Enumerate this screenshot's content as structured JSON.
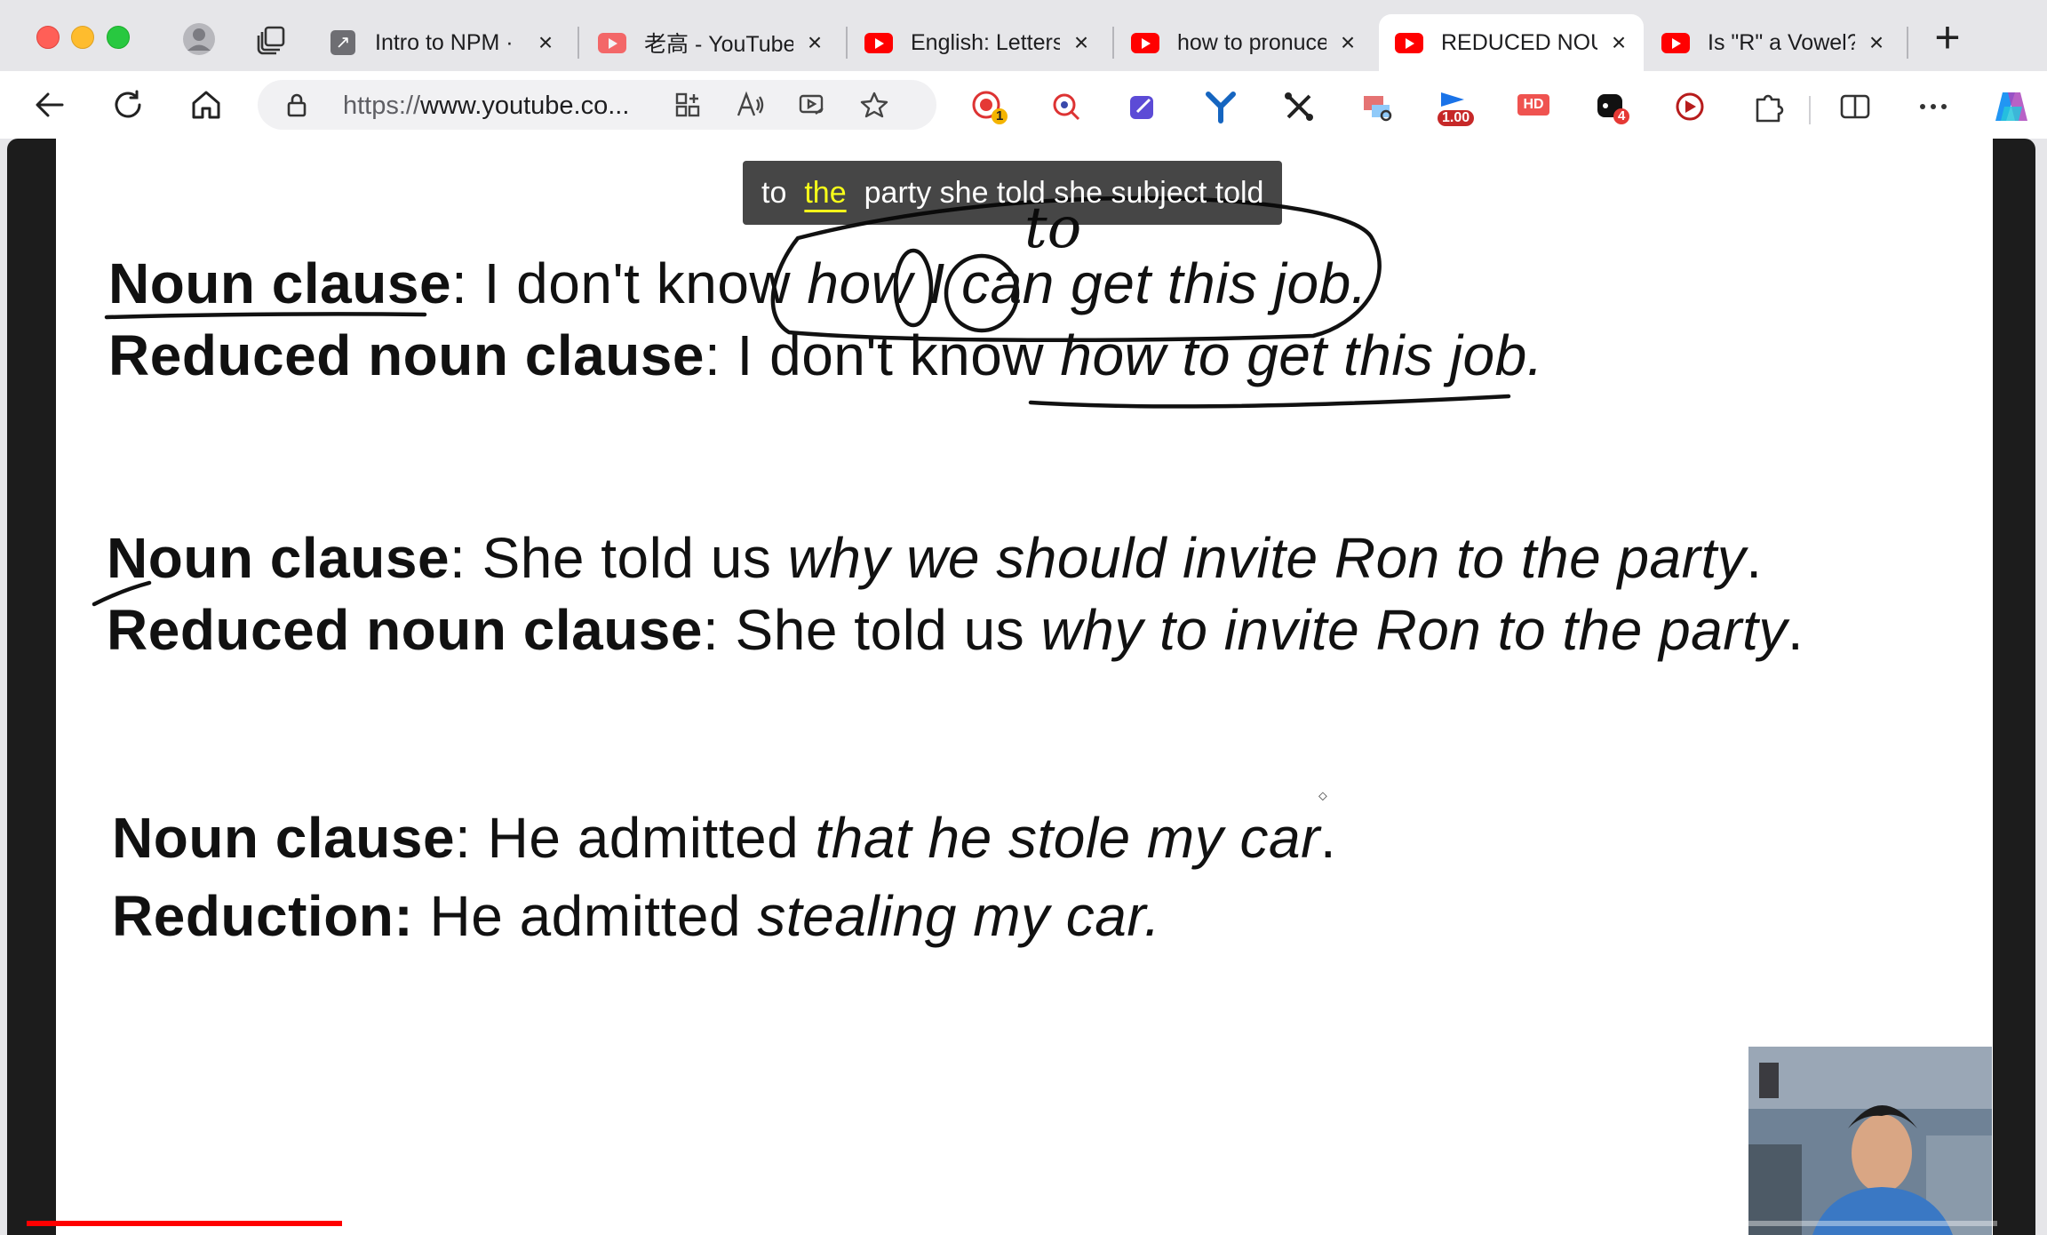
{
  "browser": {
    "tabs": [
      {
        "title": "Intro to NPM ·",
        "icon": "external-link-icon",
        "active": false
      },
      {
        "title": "老高 - YouTube",
        "icon": "youtube-icon",
        "active": false
      },
      {
        "title": "English: Letters",
        "icon": "youtube-icon",
        "active": false
      },
      {
        "title": "how to pronuce",
        "icon": "youtube-icon",
        "active": false
      },
      {
        "title": "REDUCED NOUN",
        "icon": "youtube-icon",
        "active": true
      },
      {
        "title": "Is \"R\" a Vowel?",
        "icon": "youtube-icon",
        "active": false
      }
    ],
    "new_tab_label": "+",
    "address": {
      "scheme": "https://",
      "host": "www.youtube.co..."
    },
    "extensions": {
      "record_badge": "1",
      "speed_badge": "1.00",
      "hd_label": "HD",
      "notif_badge": "4"
    }
  },
  "video": {
    "caption": {
      "before": "to",
      "highlight": "the",
      "after": "party she told she subject told"
    },
    "annotation": "to",
    "progress": 0.16,
    "slide": {
      "l1": {
        "label": "Noun clause",
        "sep": ": ",
        "plain": "I don't know ",
        "italic": "how I can get this job."
      },
      "l2": {
        "label": "Reduced noun clause",
        "sep": ": ",
        "plain": "I don't know ",
        "italic": "how to get this job."
      },
      "l3": {
        "label": "Noun clause",
        "sep": ": ",
        "plain": "She told us ",
        "italic": "why we should invite Ron to the party",
        "end": "."
      },
      "l4": {
        "label": "Reduced noun clause",
        "sep": ": ",
        "plain": "She told us ",
        "italic": "why to invite Ron to the party",
        "end": "."
      },
      "l5": {
        "label": "Noun clause",
        "sep": ": ",
        "plain": "He admitted ",
        "italic": "that he stole my car",
        "end": "."
      },
      "l6": {
        "label": "Reduction:",
        "sep": " ",
        "plain": "He admitted ",
        "italic": "stealing my car."
      }
    }
  },
  "colors": {
    "caption_highlight": "#f7ff1a",
    "progress": "#ff0000",
    "youtube": "#ff0000"
  }
}
